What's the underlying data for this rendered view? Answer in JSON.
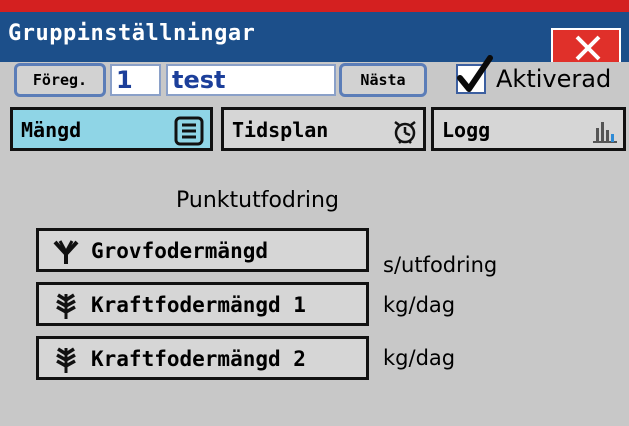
{
  "window": {
    "title": "Gruppinställningar",
    "close_icon": "close-icon"
  },
  "nav": {
    "prev_label": "Föreg.",
    "group_number": "1",
    "group_name": "test",
    "next_label": "Nästa",
    "activated_label": "Aktiverad",
    "activated_checked": true
  },
  "tabs": [
    {
      "label": "Mängd",
      "icon": "list-icon",
      "active": true
    },
    {
      "label": "Tidsplan",
      "icon": "alarm-clock-icon",
      "active": false
    },
    {
      "label": "Logg",
      "icon": "bar-chart-icon",
      "active": false
    }
  ],
  "main": {
    "heading": "Punktutfodring",
    "rows": [
      {
        "label": "Grovfodermängd",
        "unit": "s/utfodring",
        "icon": "roughage-icon"
      },
      {
        "label": "Kraftfodermängd 1",
        "unit": "kg/dag",
        "icon": "grain-icon"
      },
      {
        "label": "Kraftfodermängd 2",
        "unit": "kg/dag",
        "icon": "grain-icon"
      }
    ]
  },
  "colors": {
    "titlebar": "#1c4f8a",
    "close": "#e0302a",
    "active_tab": "#8fd5e6",
    "background": "#c8c8c8"
  }
}
